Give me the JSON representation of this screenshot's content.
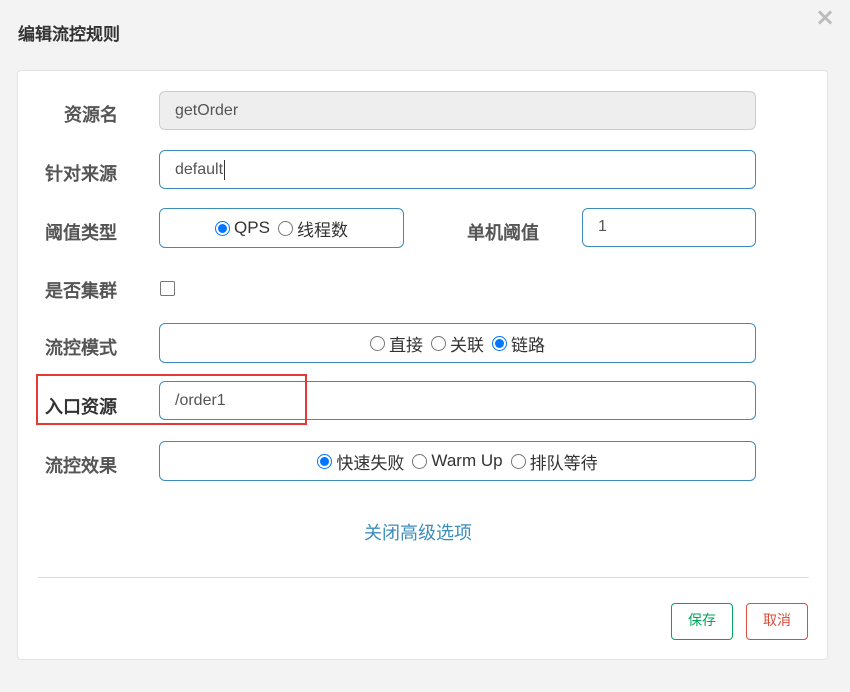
{
  "dialog": {
    "title": "编辑流控规则",
    "close_glyph": "×"
  },
  "form": {
    "resource": {
      "label": "资源名",
      "value": "getOrder"
    },
    "limit_app": {
      "label": "针对来源",
      "value": "default"
    },
    "grade": {
      "label": "阈值类型",
      "options": [
        {
          "label": "QPS",
          "checked": true
        },
        {
          "label": "线程数",
          "checked": false
        }
      ]
    },
    "count": {
      "label": "单机阈值",
      "value": "1"
    },
    "cluster": {
      "label": "是否集群",
      "checked": false
    },
    "strategy": {
      "label": "流控模式",
      "options": [
        {
          "label": "直接",
          "checked": false
        },
        {
          "label": "关联",
          "checked": false
        },
        {
          "label": "链路",
          "checked": true
        }
      ]
    },
    "ref_resource": {
      "label": "入口资源",
      "value": "/order1"
    },
    "control_behavior": {
      "label": "流控效果",
      "options": [
        {
          "label": "快速失败",
          "checked": true
        },
        {
          "label": "Warm Up",
          "checked": false
        },
        {
          "label": "排队等待",
          "checked": false
        }
      ]
    },
    "advanced_link": "关闭高级选项"
  },
  "footer": {
    "save_label": "保存",
    "cancel_label": "取消"
  },
  "colors": {
    "accent": "#3c8dbc",
    "radio_checked": "#0075ff",
    "highlight": "#e53935",
    "save": "#00a65a",
    "cancel": "#dd4b39"
  }
}
